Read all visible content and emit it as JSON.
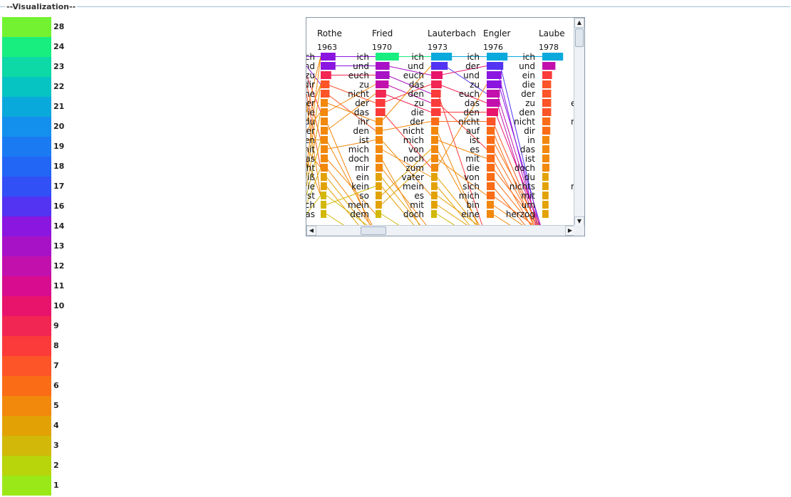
{
  "group": {
    "title": "--Visualization--"
  },
  "legend": [
    {
      "label": "28",
      "color": "#72f230"
    },
    {
      "label": "24",
      "color": "#18ee80"
    },
    {
      "label": "23",
      "color": "#0cd9a6"
    },
    {
      "label": "22",
      "color": "#06c4c2"
    },
    {
      "label": "21",
      "color": "#0aa9dc"
    },
    {
      "label": "20",
      "color": "#1390ee"
    },
    {
      "label": "19",
      "color": "#1a7af2"
    },
    {
      "label": "18",
      "color": "#2266f6"
    },
    {
      "label": "17",
      "color": "#3150f6"
    },
    {
      "label": "16",
      "color": "#5234f2"
    },
    {
      "label": "14",
      "color": "#8a16e0"
    },
    {
      "label": "13",
      "color": "#a812c6"
    },
    {
      "label": "12",
      "color": "#c210ac"
    },
    {
      "label": "11",
      "color": "#d80c8e"
    },
    {
      "label": "10",
      "color": "#e8146c"
    },
    {
      "label": "9",
      "color": "#f22652"
    },
    {
      "label": "8",
      "color": "#fb3a3a"
    },
    {
      "label": "7",
      "color": "#fd5428"
    },
    {
      "label": "6",
      "color": "#fb6c16"
    },
    {
      "label": "5",
      "color": "#f2880c"
    },
    {
      "label": "4",
      "color": "#e2a206"
    },
    {
      "label": "3",
      "color": "#d2b808"
    },
    {
      "label": "2",
      "color": "#b8d40a"
    },
    {
      "label": "1",
      "color": "#9be818"
    }
  ],
  "viz": {
    "partial_words": [
      "ch",
      "und",
      "zu",
      "dir",
      "ne",
      "er",
      "ie",
      "du",
      "er",
      "en",
      "mit",
      "as",
      "ht",
      "iß",
      "ie",
      "st",
      "ch",
      "as"
    ],
    "columns": [
      {
        "name": "Rothe",
        "year": "1963",
        "words": [
          "ich",
          "und",
          "euch",
          "zu",
          "nicht",
          "der",
          "das",
          "ihr",
          "den",
          "ist",
          "mich",
          "doch",
          "mir",
          "ein",
          "kein",
          "so",
          "mein",
          "dem"
        ],
        "ranks": [
          14,
          14,
          9,
          7,
          7,
          5,
          5,
          5,
          5,
          5,
          5,
          5,
          5,
          4,
          4,
          3,
          3,
          3
        ]
      },
      {
        "name": "Fried",
        "year": "1970",
        "words": [
          "ich",
          "und",
          "euch",
          "das",
          "den",
          "zu",
          "die",
          "der",
          "nicht",
          "mich",
          "von",
          "noch",
          "zum",
          "vater",
          "mein",
          "es",
          "mit",
          "doch"
        ],
        "ranks": [
          24,
          13,
          13,
          12,
          9,
          8,
          8,
          5,
          5,
          5,
          5,
          5,
          5,
          4,
          4,
          4,
          4,
          3
        ]
      },
      {
        "name": "Lauterbach",
        "year": "1973",
        "words": [
          "ich",
          "der",
          "und",
          "zu",
          "euch",
          "das",
          "den",
          "nicht",
          "auf",
          "ist",
          "es",
          "mit",
          "die",
          "von",
          "sich",
          "mich",
          "bin",
          "eine"
        ],
        "ranks": [
          21,
          16,
          10,
          9,
          8,
          8,
          8,
          6,
          5,
          5,
          5,
          5,
          5,
          4,
          4,
          4,
          4,
          3
        ]
      },
      {
        "name": "Engler",
        "year": "1976",
        "words": [
          "ich",
          "und",
          "ein",
          "die",
          "der",
          "zu",
          "den",
          "nicht",
          "dir",
          "in",
          "das",
          "ist",
          "doch",
          "du",
          "nichts",
          "mit",
          "um",
          "herzog"
        ],
        "ranks": [
          21,
          16,
          14,
          14,
          12,
          12,
          10,
          7,
          6,
          6,
          6,
          6,
          6,
          6,
          6,
          6,
          5,
          5
        ]
      },
      {
        "name": "Laube",
        "year": "1978",
        "words": [
          "ich",
          "",
          "",
          "",
          "",
          "",
          "",
          "",
          "",
          "",
          "",
          "",
          "",
          "",
          "",
          "",
          "",
          ""
        ],
        "ranks": [
          21,
          12,
          8,
          7,
          7,
          7,
          7,
          6,
          6,
          5,
          5,
          5,
          5,
          4,
          4,
          4,
          4,
          4
        ]
      }
    ],
    "right_partial_words": {
      "5": "e",
      "7": "n",
      "14": "m"
    }
  }
}
